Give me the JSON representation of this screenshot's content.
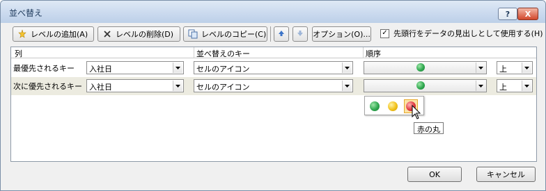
{
  "window": {
    "title": "並べ替え",
    "help_label": "?",
    "close_label": "X"
  },
  "toolbar": {
    "add_level": "レベルの追加(A)",
    "delete_level": "レベルの削除(D)",
    "copy_level": "レベルのコピー(C)",
    "options": "オプション(O)...",
    "header_checkbox_label": "先頭行をデータの見出しとして使用する(H)",
    "header_checked": true
  },
  "grid": {
    "headers": {
      "column": "列",
      "sort_on": "並べ替えのキー",
      "order": "順序"
    },
    "rows": [
      {
        "label": "最優先されるキー",
        "column": "入社日",
        "sort_on": "セルのアイコン",
        "icon_color": "#2fa84f",
        "order": "上"
      },
      {
        "label": "次に優先されるキー",
        "column": "入社日",
        "sort_on": "セルのアイコン",
        "icon_color": "#2fa84f",
        "order": "上"
      }
    ]
  },
  "icon_popup": {
    "items": [
      {
        "icon": "green-circle-icon",
        "color": "#2fa84f"
      },
      {
        "icon": "yellow-circle-icon",
        "color": "#f2c21b"
      },
      {
        "icon": "red-circle-icon",
        "color": "#e0393e"
      }
    ],
    "tooltip": "赤の丸"
  },
  "footer": {
    "ok": "OK",
    "cancel": "キャンセル"
  }
}
